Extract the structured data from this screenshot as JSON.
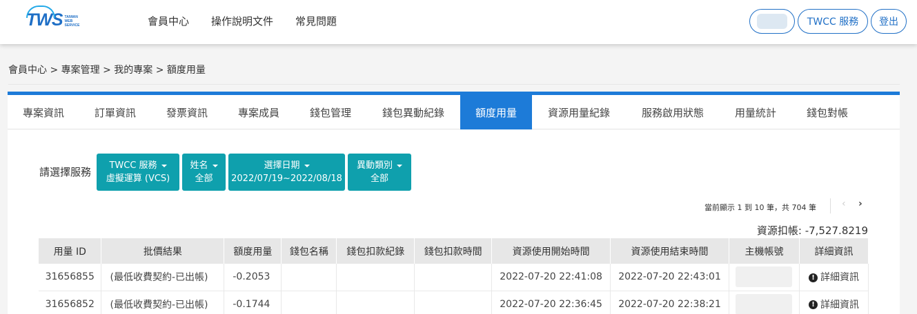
{
  "logo": {
    "main": "TWS",
    "sub_lines": [
      "TAIWAN",
      "WEB",
      "SERVICE"
    ]
  },
  "nav": [
    "會員中心",
    "操作說明文件",
    "常見問題"
  ],
  "header_buttons": {
    "service": "TWCC 服務",
    "logout": "登出"
  },
  "breadcrumb": "會員中心 > 專案管理 > 我的專案 > 額度用量",
  "tabs": [
    "專案資訊",
    "訂單資訊",
    "發票資訊",
    "專案成員",
    "錢包管理",
    "錢包異動紀錄",
    "額度用量",
    "資源用量紀錄",
    "服務啟用狀態",
    "用量統計",
    "錢包對帳"
  ],
  "active_tab": "額度用量",
  "filter": {
    "label": "請選擇服務",
    "service": {
      "line1": "TWCC 服務",
      "line2": "虛擬運算 (VCS)"
    },
    "name": {
      "line1": "姓名",
      "line2": "全部"
    },
    "date": {
      "line1": "選擇日期",
      "line2": "2022/07/19~2022/08/18"
    },
    "change_type": {
      "line1": "異動類別",
      "line2": "全部"
    }
  },
  "pager": {
    "text": "當前顯示 1 到 10 筆，共 704 筆",
    "prev": "‹",
    "next": "›"
  },
  "deduction": "資源扣帳: -7,527.8219",
  "table": {
    "headers": [
      "用量 ID",
      "批價結果",
      "額度用量",
      "錢包名稱",
      "錢包扣款紀錄",
      "錢包扣款時間",
      "資源使用開始時間",
      "資源使用結束時間",
      "主機帳號",
      "詳細資訊"
    ],
    "rows": [
      {
        "id": "31656855",
        "result": "(最低收費契約-已出帳)",
        "usage": "-0.2053",
        "wallet": "",
        "deduct_record": "",
        "deduct_time": "",
        "start": "2022-07-20 22:41:08",
        "end": "2022-07-20 22:43:01",
        "detail": "詳細資訊"
      },
      {
        "id": "31656852",
        "result": "(最低收費契約-已出帳)",
        "usage": "-0.1744",
        "wallet": "",
        "deduct_record": "",
        "deduct_time": "",
        "start": "2022-07-20 22:36:45",
        "end": "2022-07-20 22:38:21",
        "detail": "詳細資訊"
      }
    ]
  },
  "colors": {
    "brand": "#1d7bd8",
    "filter_button": "#0fa0ad",
    "link": "#1d6fc2"
  }
}
